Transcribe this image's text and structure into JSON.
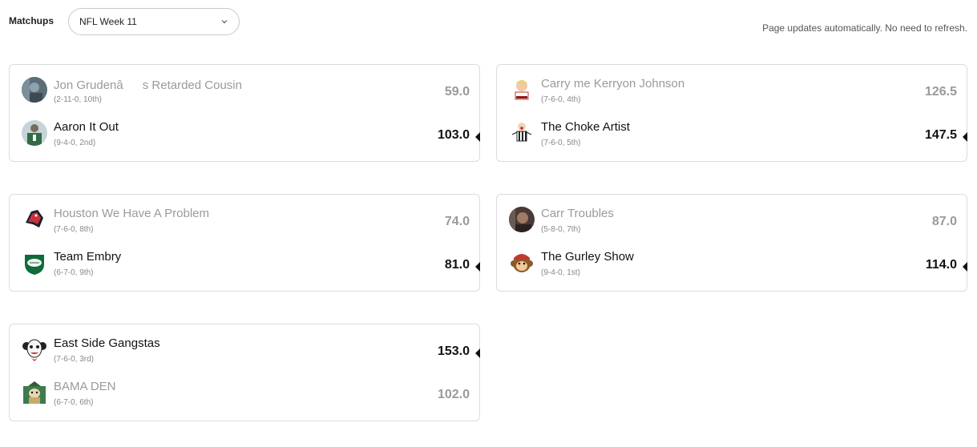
{
  "header": {
    "matchups_label": "Matchups",
    "week_selected": "NFL Week 11",
    "auto_note": "Page updates automatically. No need to refresh."
  },
  "colors": {
    "winner_text": "#111111",
    "loser_text": "#9a9a9a",
    "card_border": "#dcdcdc"
  },
  "matchups": [
    {
      "team1": {
        "name": "Jon Grudenâs Retarded Cousin",
        "record": "(2-11-0, 10th)",
        "score": "59.0",
        "avatar": "dark-photo-avatar"
      },
      "team2": {
        "name": "Aaron It Out",
        "record": "(9-4-0, 2nd)",
        "score": "103.0",
        "avatar": "green-jersey-avatar"
      },
      "winner": 2
    },
    {
      "team1": {
        "name": "Carry me Kerryon Johnson",
        "record": "(7-6-0, 4th)",
        "score": "126.5",
        "avatar": "cartoon-face-avatar"
      },
      "team2": {
        "name": "The Choke Artist",
        "record": "(7-6-0, 5th)",
        "score": "147.5",
        "avatar": "referee-avatar"
      },
      "winner": 2
    },
    {
      "team1": {
        "name": "Houston We Have A Problem",
        "record": "(7-6-0, 8th)",
        "score": "74.0",
        "avatar": "horse-logo-avatar"
      },
      "team2": {
        "name": "Team Embry",
        "record": "(6-7-0, 9th)",
        "score": "81.0",
        "avatar": "football-shield-avatar"
      },
      "winner": 2
    },
    {
      "team1": {
        "name": "Carr Troubles",
        "record": "(5-8-0, 7th)",
        "score": "87.0",
        "avatar": "person-photo-avatar"
      },
      "team2": {
        "name": "The Gurley Show",
        "record": "(9-4-0, 1st)",
        "score": "114.0",
        "avatar": "monkey-avatar"
      },
      "winner": 2
    },
    {
      "team1": {
        "name": "East Side Gangstas",
        "record": "(7-6-0, 3rd)",
        "score": "153.0",
        "avatar": "clown-avatar"
      },
      "team2": {
        "name": "BAMA DEN",
        "record": "(6-7-0, 6th)",
        "score": "102.0",
        "avatar": "green-mascot-avatar"
      },
      "winner": 1
    }
  ]
}
